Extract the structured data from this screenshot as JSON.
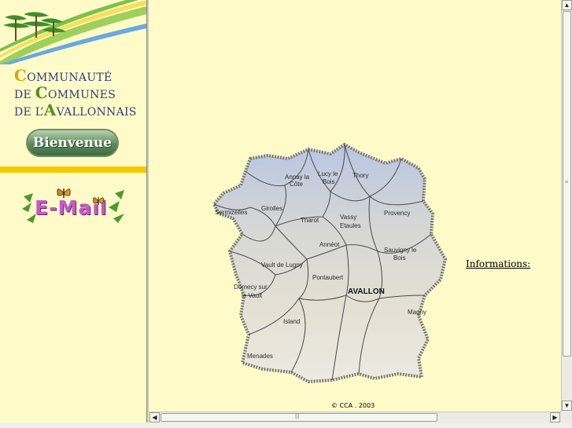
{
  "sidebar": {
    "brand_line1": {
      "cap": "C",
      "rest": "OMMUNAUTÉ"
    },
    "brand_line2": {
      "pre": "DE ",
      "cap": "C",
      "rest": "OMMUNES"
    },
    "brand_line3": {
      "pre": "DE  L’",
      "cap": "A",
      "rest": "VALLONNAIS"
    },
    "welcome_button": "Bienvenue",
    "email_link": "E-Mail"
  },
  "main": {
    "map_labels": {
      "annay": [
        "Annay la",
        "Côte"
      ],
      "lucy": [
        "Lucy le",
        "Bois"
      ],
      "thory": "Thory",
      "sermizelles": "Sermizelles",
      "girolles": "Girolles",
      "tharot": "Tharot",
      "vassy": [
        "Vassy",
        "Etaules"
      ],
      "provency": "Provency",
      "annect": "Annéot",
      "sauvigny": [
        "Sauvigny le",
        "Bois"
      ],
      "vault": "Vault de Lugny",
      "pontaubert": "Pontaubert",
      "domecy": [
        "Domecy sur",
        "le Vault"
      ],
      "avallon": "AVALLON",
      "magny": "Magny",
      "island": "Island",
      "menades": "Menades"
    },
    "informations_link": "Informations:",
    "copyright": "© CCA . 2003"
  },
  "colors": {
    "background": "#fffbc8",
    "brand_blue": "#2d3f7a",
    "brand_yellow": "#d7a600",
    "brand_green": "#4f8f24",
    "band_yellow": "#f6c800"
  },
  "icons": [
    "trees-logo",
    "butterfly-icon",
    "arrow-up-icon",
    "arrow-down-icon",
    "arrow-left-icon",
    "arrow-right-icon"
  ]
}
